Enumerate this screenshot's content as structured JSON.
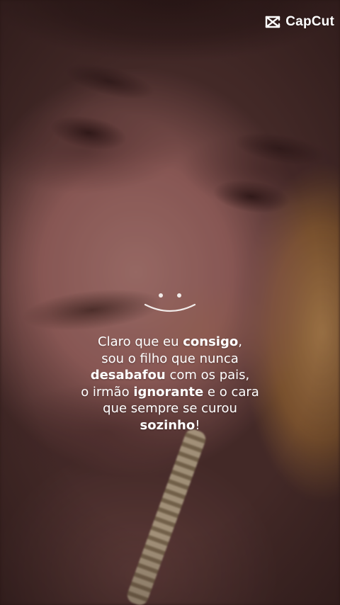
{
  "watermark": {
    "brand_text": "CapCut",
    "icon": "capcut-logo-icon"
  },
  "decoration": {
    "icon": "smiley-face-icon"
  },
  "caption": {
    "lines": [
      [
        {
          "text": "Claro que eu ",
          "bold": false
        },
        {
          "text": "consigo",
          "bold": true
        },
        {
          "text": ",",
          "bold": false
        }
      ],
      [
        {
          "text": "sou o filho que nunca",
          "bold": false
        }
      ],
      [
        {
          "text": "desabafou",
          "bold": true
        },
        {
          "text": " com os pais,",
          "bold": false
        }
      ],
      [
        {
          "text": "o irmão ",
          "bold": false
        },
        {
          "text": "ignorante",
          "bold": true
        },
        {
          "text": " e o cara",
          "bold": false
        }
      ],
      [
        {
          "text": "que sempre se curou",
          "bold": false
        }
      ],
      [
        {
          "text": "sozinho",
          "bold": true
        },
        {
          "text": "!",
          "bold": false
        }
      ]
    ]
  },
  "colors": {
    "text": "#ffffff"
  }
}
